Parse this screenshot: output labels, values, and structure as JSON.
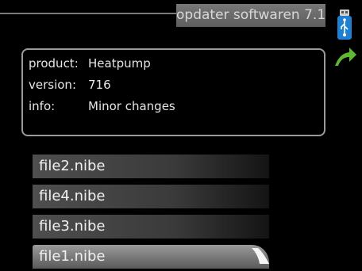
{
  "header": {
    "title": "opdater softwaren 7.1",
    "icons": [
      "usb-icon",
      "back-arrow-icon"
    ]
  },
  "info": {
    "rows": [
      {
        "key": "product:",
        "value": "Heatpump"
      },
      {
        "key": "version:",
        "value": "716"
      },
      {
        "key": "info:",
        "value": "Minor changes"
      }
    ]
  },
  "files": {
    "items": [
      {
        "label": "file2.nibe"
      },
      {
        "label": "file4.nibe"
      },
      {
        "label": "file3.nibe"
      },
      {
        "label": "file1.nibe"
      }
    ],
    "selected": "file1.nibe"
  },
  "colors": {
    "background": "#000000",
    "usb_blue": "#1f7fd0",
    "arrow_green": "#5fb832"
  }
}
